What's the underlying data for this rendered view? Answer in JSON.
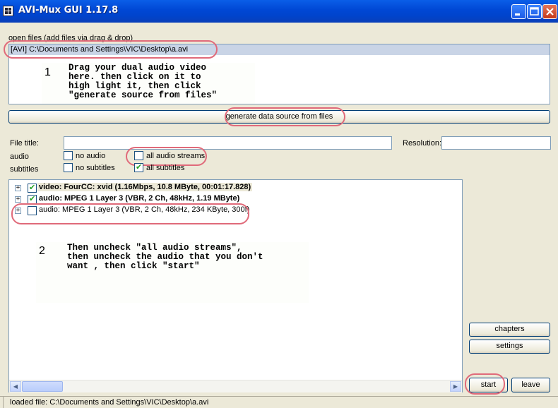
{
  "window": {
    "title": "AVI-Mux GUI 1.17.8"
  },
  "open_files": {
    "label": "open files (add files via drag & drop)",
    "items": [
      "[AVI] C:\\Documents and Settings\\VIC\\Desktop\\a.avi"
    ]
  },
  "instructions": {
    "step1_number": "1",
    "step1_text": "Drag your dual audio video\nhere. then click on it to\nhigh light it, then click\n\"generate source from files\"",
    "step2_number": "2",
    "step2_text": "Then uncheck \"all audio streams\",\nthen uncheck the audio that you don't\nwant , then click \"start\""
  },
  "generate_button_label": "generate data source from files",
  "form": {
    "file_title_label": "File title:",
    "resolution_label": "Resolution:",
    "audio_label": "audio",
    "subtitles_label": "subtitles",
    "no_audio_label": "no audio",
    "no_audio_checked": false,
    "all_audio_label": "all audio streams",
    "all_audio_checked": false,
    "no_subtitles_label": "no subtitles",
    "no_subtitles_checked": false,
    "all_subtitles_label": "all subtitles",
    "all_subtitles_checked": true
  },
  "streams": [
    {
      "label": "video: FourCC: xvid (1.16Mbps, 10.8 MByte, 00:01:17.828)",
      "checked": true,
      "bold": true
    },
    {
      "label": "audio: MPEG 1 Layer 3 (VBR, 2 Ch, 48kHz, 1.19 MByte)",
      "checked": true,
      "bold": true
    },
    {
      "label": "audio: MPEG 1 Layer 3 (VBR, 2 Ch, 48kHz, 234 KByte, 300f)",
      "checked": false,
      "bold": false
    }
  ],
  "buttons": {
    "chapters": "chapters",
    "settings": "settings",
    "start": "start",
    "leave": "leave"
  },
  "status_bar": {
    "text": "loaded file: C:\\Documents and Settings\\VIC\\Desktop\\a.avi"
  },
  "colors": {
    "titlebar": "#0054e3",
    "annotation": "#e06a7a",
    "window_bg": "#ece9d8"
  }
}
